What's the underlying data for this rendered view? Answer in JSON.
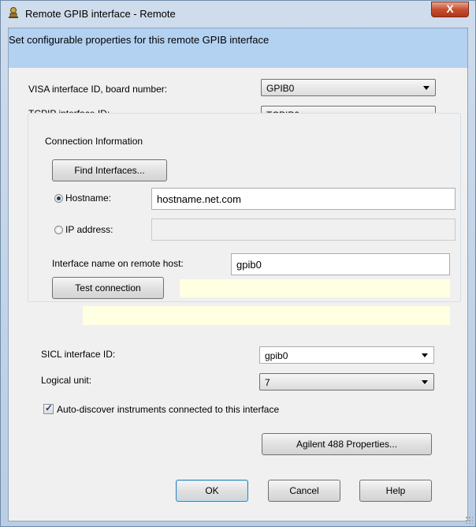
{
  "window": {
    "title": "Remote GPIB interface - Remote",
    "close_label": "X"
  },
  "banner": {
    "text": "Set configurable properties for this remote GPIB interface"
  },
  "visa": {
    "label": "VISA interface ID, board number:",
    "value": "GPIB0"
  },
  "tcpip": {
    "label": "TCPIP interface ID:",
    "value": "TCPIP0"
  },
  "connection": {
    "group_title": "Connection Information",
    "find_button": "Find Interfaces...",
    "hostname_label": "Hostname:",
    "hostname_value": "hostname.net.com",
    "hostname_selected": true,
    "ip_label": "IP address:",
    "ip_value": "",
    "remote_name_label": "Interface name on remote host:",
    "remote_name_value": "gpib0",
    "test_button": "Test connection",
    "status_1": "",
    "status_2": ""
  },
  "sicl": {
    "label": "SICL interface ID:",
    "value": "gpib0"
  },
  "logical_unit": {
    "label": "Logical unit:",
    "value": "7"
  },
  "auto_discover": {
    "label": "Auto-discover instruments connected to this interface",
    "checked": true
  },
  "buttons": {
    "properties": "Agilent 488 Properties...",
    "ok": "OK",
    "cancel": "Cancel",
    "help": "Help"
  },
  "colors": {
    "banner": "#b3d2f2",
    "status_bg": "#ffffe1",
    "title_gradient": "#cfdcec"
  }
}
